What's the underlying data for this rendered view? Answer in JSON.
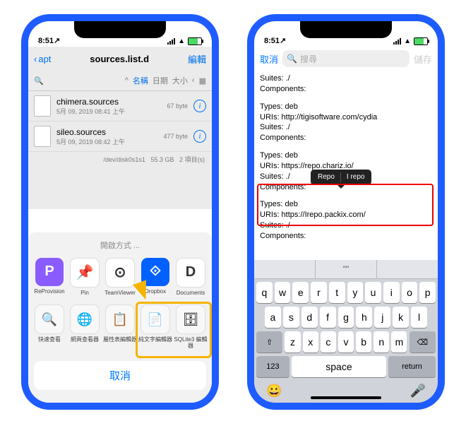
{
  "phone1": {
    "status": {
      "time": "8:51",
      "arrow": "↗"
    },
    "nav": {
      "back": "apt",
      "title": "sources.list.d",
      "edit": "編輯"
    },
    "sort": {
      "name": "名稱",
      "date": "日期",
      "size": "大小"
    },
    "files": [
      {
        "name": "chimera.sources",
        "meta": "5月 09, 2019 08:41 上午",
        "size": "67 byte"
      },
      {
        "name": "sileo.sources",
        "meta": "5月 09, 2019 08:42 上午",
        "size": "477 byte"
      }
    ],
    "footer": {
      "disk": "/dev/disk0s1s1",
      "free": "55.3 GB",
      "count": "2 項目(s)"
    },
    "sheet": {
      "title": "開啟方式 ...",
      "apps": [
        {
          "label": "ReProvision",
          "bg": "#8a5cff",
          "letter": "P"
        },
        {
          "label": "Pin",
          "bg": "#ffffff",
          "letter": "📌"
        },
        {
          "label": "TeamViewer",
          "bg": "#ffffff",
          "letter": "⊙"
        },
        {
          "label": "Dropbox",
          "bg": "#0061ff",
          "letter": "⟐"
        },
        {
          "label": "Documents",
          "bg": "#ffffff",
          "letter": "D"
        }
      ],
      "actions": [
        {
          "label": "快速查看",
          "glyph": "🔍"
        },
        {
          "label": "網頁查看器",
          "glyph": "🌐"
        },
        {
          "label": "屬性表編輯器",
          "glyph": "📋"
        },
        {
          "label": "純文字編輯器",
          "glyph": "📄"
        },
        {
          "label": "SQLite3 編輯器",
          "glyph": "🗄"
        }
      ],
      "cancel": "取消"
    }
  },
  "phone2": {
    "status": {
      "time": "8:51",
      "arrow": "↗"
    },
    "nav": {
      "cancel": "取消",
      "search_placeholder": "搜尋",
      "save": "儲存"
    },
    "textblocks": [
      "Suites: ./\nComponents:",
      "Types: deb\nURIs: http://tigisoftware.com/cydia\nSuites: ./\nComponents:",
      "Types: deb\nURIs: https://repo.chariz.io/\nSuites: ./\nComponents:",
      "Types: deb\nURIs: https://Irepo.packix.com/\nSuites: ./\nComponents:"
    ],
    "tooltip": {
      "opt1": "Repo",
      "opt2": "I repo"
    },
    "keyboard": {
      "suggestions": [
        "",
        "\"\"",
        ""
      ],
      "row1": [
        "q",
        "w",
        "e",
        "r",
        "t",
        "y",
        "u",
        "i",
        "o",
        "p"
      ],
      "row2": [
        "a",
        "s",
        "d",
        "f",
        "g",
        "h",
        "j",
        "k",
        "l"
      ],
      "row3": [
        "z",
        "x",
        "c",
        "v",
        "b",
        "n",
        "m"
      ],
      "shift": "⇧",
      "delete": "⌫",
      "num": "123",
      "space": "space",
      "return": "return",
      "emoji": "😀",
      "mic": "🎤"
    }
  }
}
